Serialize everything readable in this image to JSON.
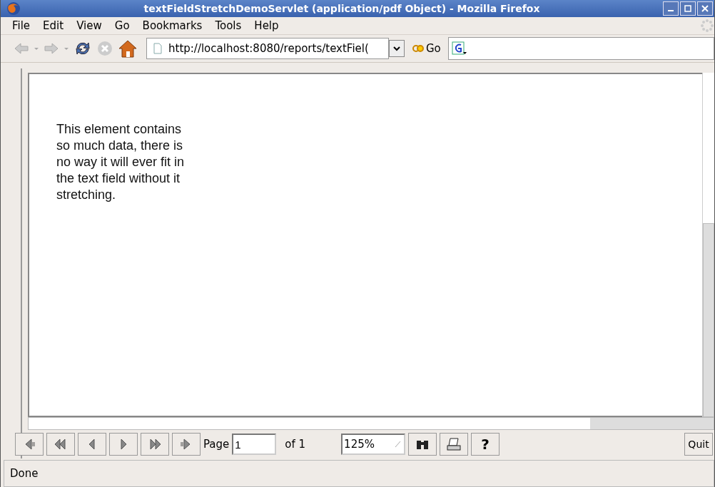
{
  "window": {
    "title": "textFieldStretchDemoServlet (application/pdf Object) - Mozilla Firefox"
  },
  "menu": [
    "File",
    "Edit",
    "View",
    "Go",
    "Bookmarks",
    "Tools",
    "Help"
  ],
  "toolbar": {
    "url": "http://localhost:8080/reports/textFiel(",
    "go": "Go"
  },
  "document": {
    "lines": [
      "This element contains",
      "so much data, there is",
      "no way it will ever fit in",
      "the text field without it",
      "stretching."
    ]
  },
  "pdf_toolbar": {
    "page_label": "Page",
    "page": "1",
    "of": "of 1",
    "zoom": "125%",
    "help": "?",
    "quit": "Quit"
  },
  "status_bar": "Done"
}
